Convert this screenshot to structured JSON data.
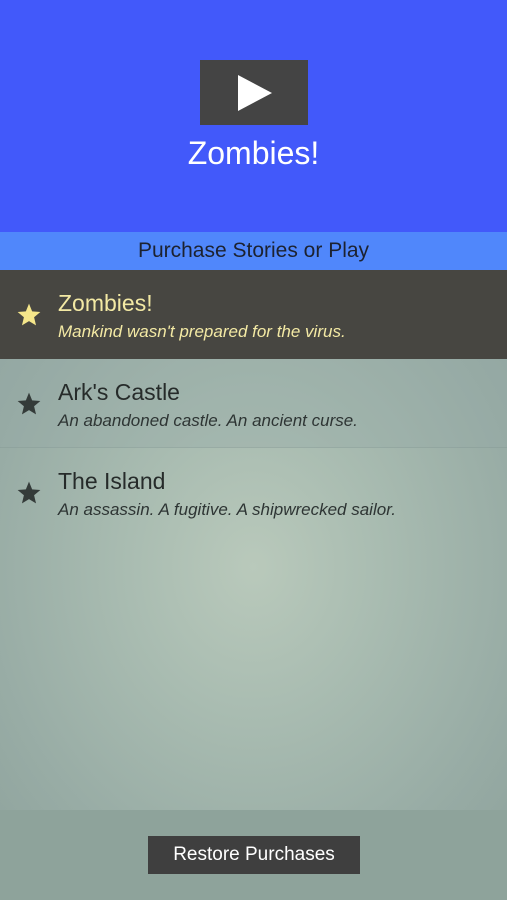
{
  "header": {
    "title": "Zombies!",
    "play_icon": "play-icon",
    "background_color": "#4259fa"
  },
  "subheader": {
    "label": "Purchase Stories or Play",
    "background_color": "#5087fb"
  },
  "stories": [
    {
      "name": "Zombies!",
      "description": "Mankind wasn't prepared for the virus.",
      "icon": "star-icon",
      "selected": true,
      "star_color": "#f5e68a"
    },
    {
      "name": "Ark's Castle",
      "description": "An abandoned castle. An ancient curse.",
      "icon": "star-icon",
      "selected": false,
      "star_color": "#343b39"
    },
    {
      "name": "The Island",
      "description": "An assassin. A fugitive. A shipwrecked sailor.",
      "icon": "star-icon",
      "selected": false,
      "star_color": "#343b39"
    }
  ],
  "footer": {
    "restore_label": "Restore Purchases"
  }
}
